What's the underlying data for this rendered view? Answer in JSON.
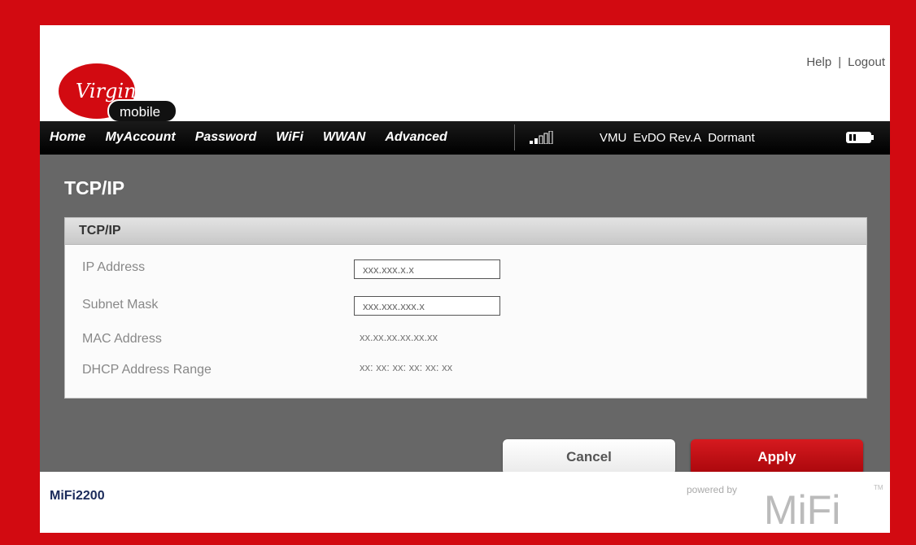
{
  "header": {
    "logo": {
      "brand_top": "Virgin",
      "brand_bottom": "mobile"
    },
    "links": {
      "help": "Help",
      "separator": "|",
      "logout": "Logout"
    }
  },
  "nav": {
    "items": [
      "Home",
      "MyAccount",
      "Password",
      "WiFi",
      "WWAN",
      "Advanced"
    ],
    "status": {
      "carrier": "VMU",
      "network": "EvDO Rev.A",
      "state": "Dormant"
    },
    "signal_bars_active": 2,
    "signal_bars_total": 5
  },
  "page": {
    "title": "TCP/IP"
  },
  "panel": {
    "title": "TCP/IP",
    "fields": {
      "ip_address": {
        "label": "IP Address",
        "value": "xxx.xxx.x.x"
      },
      "subnet_mask": {
        "label": "Subnet Mask",
        "value": "xxx.xxx.xxx.x"
      },
      "mac_address": {
        "label": "MAC Address",
        "value": "xx.xx.xx.xx.xx.xx"
      },
      "dhcp_range": {
        "label": "DHCP Address Range",
        "value": "xx: xx: xx: xx: xx: xx"
      }
    }
  },
  "buttons": {
    "cancel": "Cancel",
    "apply": "Apply"
  },
  "footer": {
    "model": "MiFi2200",
    "powered_by": "powered by",
    "brand": "MiFi",
    "tm": "TM"
  },
  "colors": {
    "border_red": "#d20a11",
    "main_gray": "#676767",
    "apply_red": "#b80d12"
  }
}
